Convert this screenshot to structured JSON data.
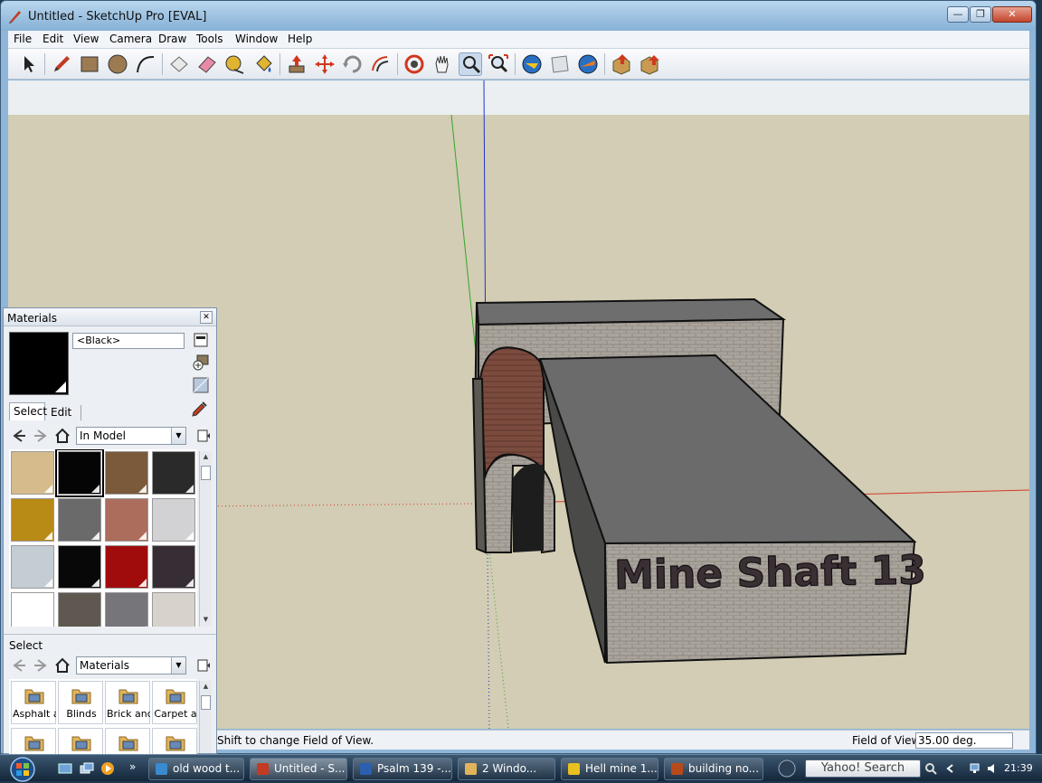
{
  "window": {
    "title": "Untitled - SketchUp Pro [EVAL]",
    "min_label": "—",
    "max_label": "❐",
    "close_label": "✕"
  },
  "menu": [
    "File",
    "Edit",
    "View",
    "Camera",
    "Draw",
    "Tools",
    "Window",
    "Help"
  ],
  "toolbar": {
    "tools": [
      "select-tool-icon",
      "pencil-icon",
      "rectangle-icon",
      "circle-icon",
      "arc-icon",
      "make-component-icon",
      "eraser-icon",
      "tape-measure-icon",
      "paint-bucket-icon",
      "push-pull-icon",
      "move-icon",
      "rotate-icon",
      "offset-icon",
      "orbit-icon",
      "pan-icon",
      "zoom-icon",
      "zoom-extents-icon",
      "get-models-icon",
      "share-model-icon",
      "google-earth-icon",
      "get-components-icon",
      "share-component-icon"
    ],
    "active_tool": "zoom-icon"
  },
  "viewport": {
    "sign_text": "Mine Shaft 13",
    "colors": {
      "ground": "#d2cdb4",
      "sky": "#ebeff1",
      "roof": "#6b6b6b",
      "brick": "#a7a29a",
      "arch": "#7a4a3c"
    }
  },
  "status": {
    "hint": "Shift to change Field of View.",
    "fov_label": "Field of View",
    "fov_value": "35.00 deg."
  },
  "materials": {
    "title": "Materials",
    "close_label": "✕",
    "current_name": "<Black>",
    "tabs": [
      "Select",
      "Edit"
    ],
    "collection": "In Model",
    "swatches": [
      "#d6bc8c",
      "#050505",
      "#7a5a3a",
      "#2a2a2a",
      "#b88a16",
      "#6a6a6a",
      "#ad6d5c",
      "#d2d2d4",
      "#c4ccd4",
      "#080808",
      "#a00c0c",
      "#362e34",
      "#ffffff",
      "#5e5850",
      "#76767a",
      "#d8d2cc"
    ],
    "selected_swatch": 1,
    "secondary_label": "Select",
    "library": "Materials",
    "library_items": [
      "Asphalt a",
      "Blinds",
      "Brick and",
      "Carpet a",
      "",
      "",
      "",
      ""
    ]
  },
  "taskbar": {
    "tasks": [
      {
        "label": "old wood t...",
        "icon": "browser-icon"
      },
      {
        "label": "Untitled - S...",
        "icon": "sketchup-icon"
      },
      {
        "label": "Psalm 139 -...",
        "icon": "word-icon"
      },
      {
        "label": "2 Windo...",
        "icon": "folder-icon"
      },
      {
        "label": "Hell mine 1...",
        "icon": "image-icon"
      },
      {
        "label": "building no...",
        "icon": "document-icon"
      }
    ],
    "active_task": 1,
    "search_label": "Yahoo! Search",
    "clock": "21:39",
    "more_label": "»"
  }
}
